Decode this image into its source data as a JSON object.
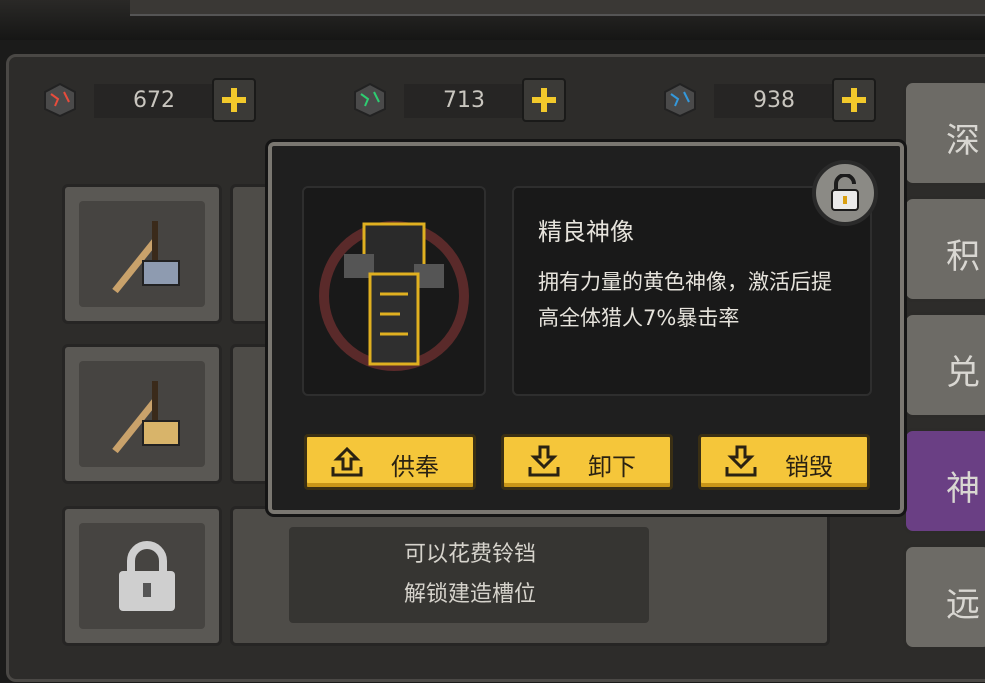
{
  "resources": [
    {
      "icon": "red-gem-cube-icon",
      "value": "672",
      "color": "#c0392b"
    },
    {
      "icon": "green-gem-cube-icon",
      "value": "713",
      "color": "#2ecc71"
    },
    {
      "icon": "blue-gem-cube-icon",
      "value": "938",
      "color": "#3498db"
    }
  ],
  "side_tabs": [
    "深",
    "积",
    "兑",
    "神",
    "远"
  ],
  "locked_slot": {
    "line1": "可以花费铃铛",
    "line2": "解锁建造槽位"
  },
  "modal": {
    "title": "精良神像",
    "description": "拥有力量的黄色神像，激活后提高全体猎人7%暴击率",
    "buttons": {
      "offer": "供奉",
      "unload": "卸下",
      "destroy": "销毁"
    }
  },
  "colors": {
    "accent": "#f5c63a",
    "active_tab": "#6a3f84"
  }
}
